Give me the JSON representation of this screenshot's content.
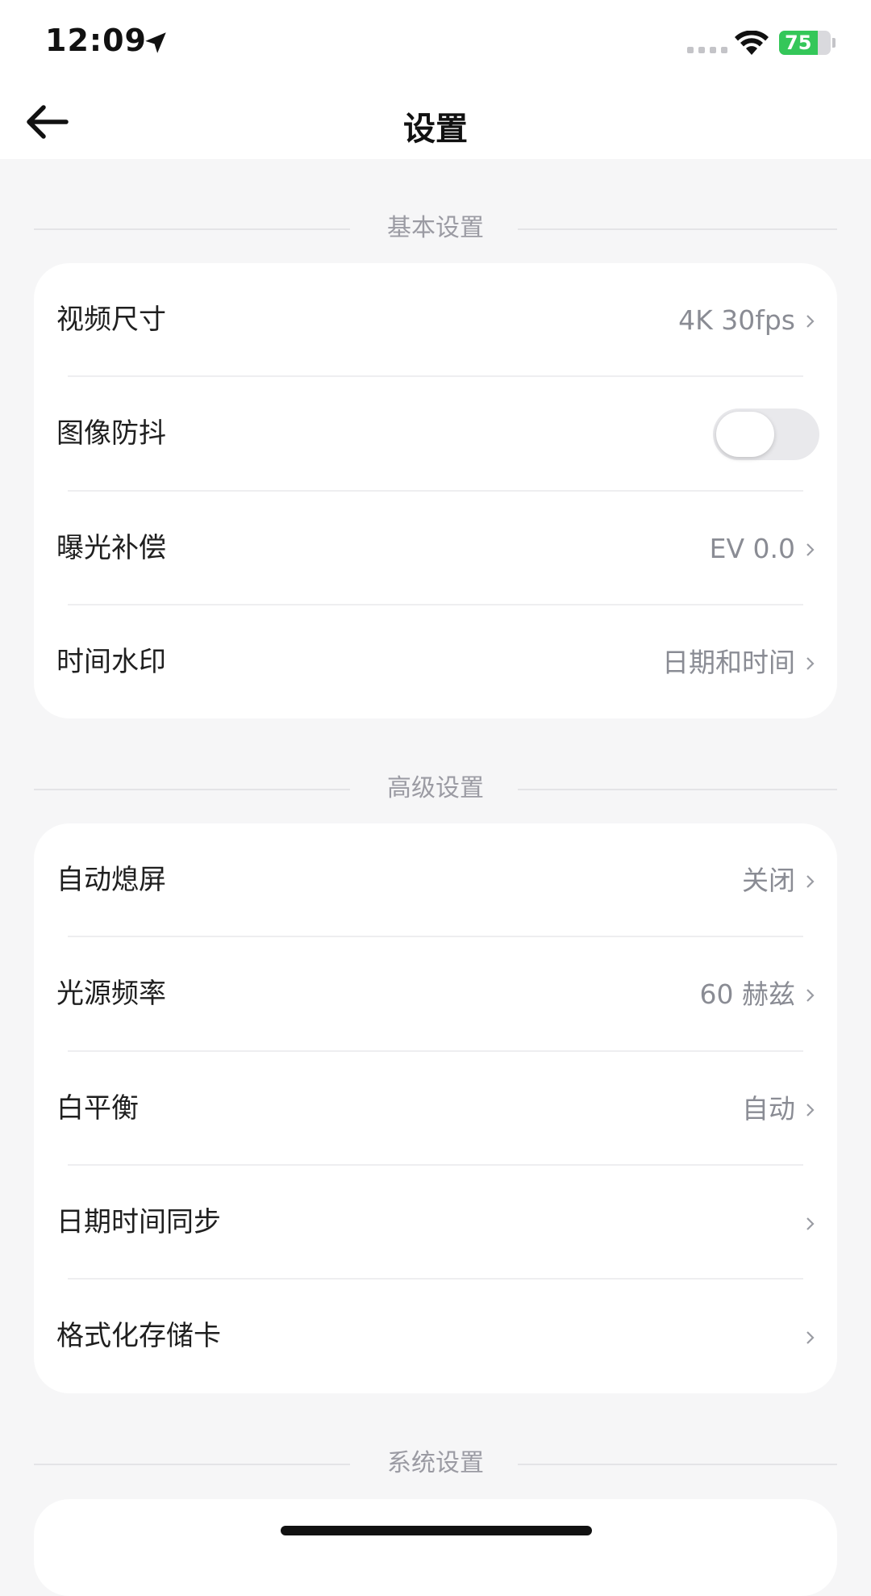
{
  "status_bar": {
    "time": "12:09",
    "battery_percent": "75",
    "battery_level": 0.75
  },
  "nav": {
    "title": "设置"
  },
  "sections": [
    {
      "header": "基本设置",
      "items": [
        {
          "title": "视频尺寸",
          "value": "4K 30fps"
        },
        {
          "title": "图像防抖",
          "toggle": false
        },
        {
          "title": "曝光补偿",
          "value": "EV 0.0"
        },
        {
          "title": "时间水印",
          "value": "日期和时间"
        }
      ]
    },
    {
      "header": "高级设置",
      "items": [
        {
          "title": "自动熄屏",
          "value": "关闭"
        },
        {
          "title": "光源频率",
          "value": "60 赫兹"
        },
        {
          "title": "白平衡",
          "value": "自动"
        },
        {
          "title": "日期时间同步",
          "value": ""
        },
        {
          "title": "格式化存储卡",
          "value": ""
        }
      ]
    },
    {
      "header": "系统设置"
    }
  ],
  "colors": {
    "accent_battery": "#34c759",
    "background": "#f6f6f7",
    "card": "#ffffff",
    "secondary_text": "#8a8c94"
  }
}
